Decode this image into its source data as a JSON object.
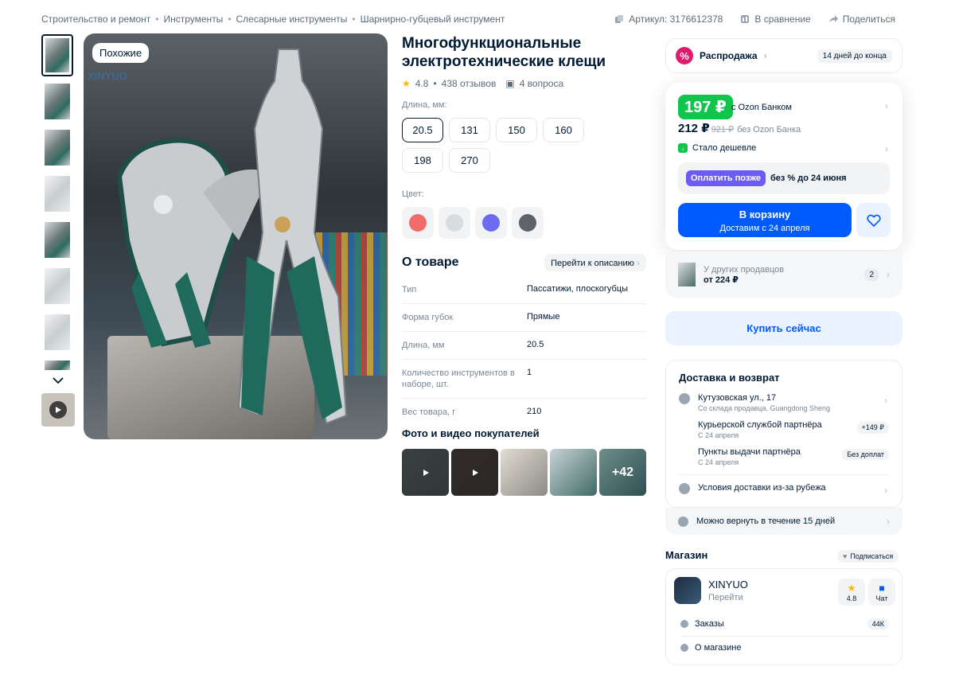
{
  "breadcrumbs": [
    "Строительство и ремонт",
    "Инструменты",
    "Слесарные инструменты",
    "Шарнирно-губцевый инструмент"
  ],
  "top_actions": {
    "article": "Артикул: 3176612378",
    "compare": "В сравнение",
    "share": "Поделиться"
  },
  "gallery": {
    "similar_label": "Похожие",
    "watermark": "XINYUO"
  },
  "product": {
    "title": "Многофункциональные электротехнические клещи",
    "rating": "4.8",
    "reviews": "438 отзывов",
    "questions": "4 вопроса",
    "length_label": "Длина, мм:",
    "lengths": [
      "20.5",
      "131",
      "150",
      "160",
      "198",
      "270"
    ],
    "color_label": "Цвет:",
    "colors": [
      "#f26b6b",
      "#d9dbde",
      "#6c6cf0",
      "#5f6266"
    ]
  },
  "about": {
    "title": "О товаре",
    "goto": "Перейти к описанию",
    "specs": [
      {
        "k": "Тип",
        "v": "Пассатижи, плоскогубцы"
      },
      {
        "k": "Форма губок",
        "v": "Прямые"
      },
      {
        "k": "Длина, мм",
        "v": "20.5"
      },
      {
        "k": "Количество инструментов в наборе, шт.",
        "v": "1"
      },
      {
        "k": "Вес товара, г",
        "v": "210"
      }
    ]
  },
  "ugc": {
    "title": "Фото и видео покупателей",
    "more": "+42"
  },
  "sale": {
    "label": "Распродажа",
    "days": "14 дней до конца"
  },
  "price": {
    "bank_price": "197 ₽",
    "with_bank": "с Ozon Банком",
    "price": "212 ₽",
    "old_price": "921 ₽",
    "no_bank": "без Ozon Банка",
    "cheaper": "Стало дешевле",
    "pay_later": "Оплатить позже",
    "pay_later_note": "без % до 24 июня",
    "cart": "В корзину",
    "cart_sub": "Доставим с 24 апреля"
  },
  "other_sellers": {
    "label": "У других продавцов",
    "from": "от 224 ₽",
    "count": "2"
  },
  "buy_now": "Купить сейчас",
  "delivery": {
    "title": "Доставка и возврат",
    "address": "Кутузовская ул., 17",
    "address_sub": "Со склада продавца, Guangdong Sheng",
    "courier": "Курьерской службой партнёра",
    "courier_sub": "С 24 апреля",
    "courier_price": "+149 ₽",
    "pickup": "Пункты выдачи партнёра",
    "pickup_sub": "С 24 апреля",
    "pickup_price": "Без доплат",
    "abroad": "Условия доставки из-за рубежа",
    "return": "Можно вернуть в течение 15 дней"
  },
  "shop": {
    "title": "Магазин",
    "subscribe": "Подписаться",
    "name": "XINYUO",
    "go": "Перейти",
    "rating": "4.8",
    "chat": "Чат",
    "orders": "Заказы",
    "orders_count": "44К",
    "about": "О магазине"
  }
}
